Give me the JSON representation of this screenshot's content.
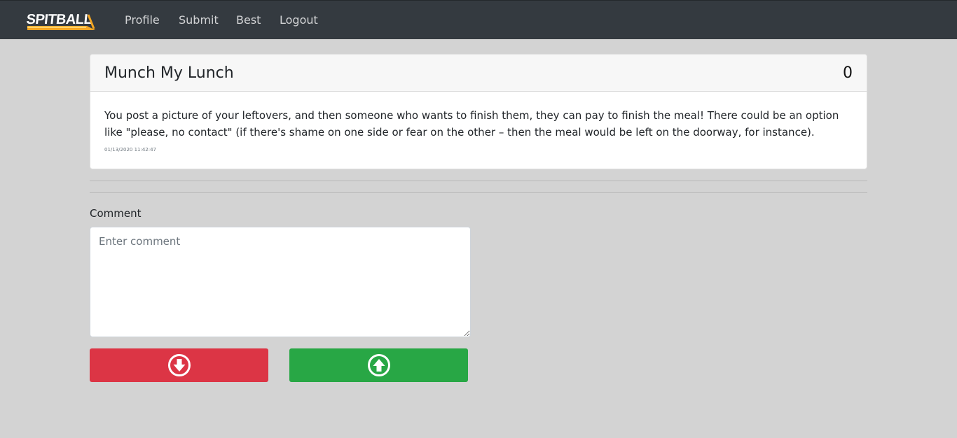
{
  "navbar": {
    "logo_text": "SPITBALL",
    "links": [
      "Profile",
      "Submit",
      "Best",
      "Logout"
    ]
  },
  "post": {
    "title": "Munch My Lunch",
    "score": "0",
    "body": "You post a picture of your leftovers, and then someone who wants to finish them, they can pay to finish the meal! There could be an option like \"please, no contact\" (if there's shame on one side or fear on the other – then the meal would be left on the doorway, for instance).",
    "timestamp": "01/13/2020 11:42:47"
  },
  "comment": {
    "label": "Comment",
    "placeholder": "Enter comment",
    "value": ""
  },
  "vote": {
    "down_icon": "arrow-circle-down-icon",
    "up_icon": "arrow-circle-up-icon"
  },
  "colors": {
    "navbar_bg": "#343a40",
    "page_bg": "#d3d3d3",
    "downvote": "#dc3545",
    "upvote": "#28a745",
    "logo_accent": "#f5a623"
  }
}
